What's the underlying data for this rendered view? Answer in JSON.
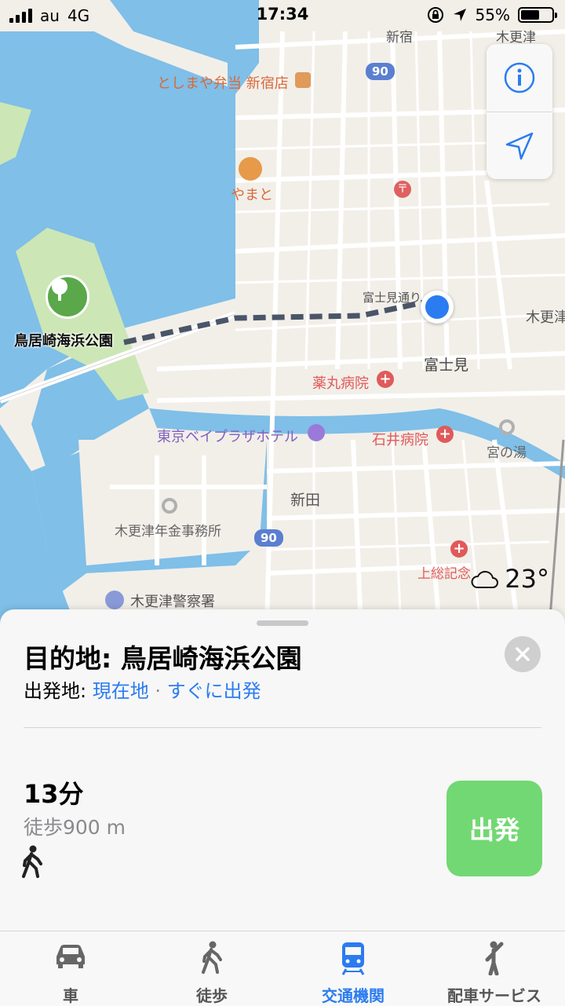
{
  "status_bar": {
    "carrier": "au",
    "network": "4G",
    "time": "17:34",
    "battery": "55%",
    "battery_level": 0.55
  },
  "map": {
    "labels": {
      "shinshuku_top": "新宿",
      "kisarazu_top": "木更津",
      "route_90_top": "90",
      "toshimaya": "としまや弁当 新宿店",
      "yamato": "やまと",
      "fujimi_street": "富士見通り",
      "kisarazu_right": "木更津",
      "park": "鳥居崎海浜公園",
      "fujimi": "富士見",
      "yakumaru": "薬丸病院",
      "hotel": "東京ベイプラザホテル",
      "ishii": "石井病院",
      "miyanoyu": "宮の湯",
      "shinden": "新田",
      "pension": "木更津年金事務所",
      "route_90_bottom": "90",
      "kazusa": "上総記念",
      "police": "木更津警察署"
    },
    "colors": {
      "water": "#7fbfe8",
      "land": "#f2efe9",
      "park": "#cde6b6",
      "route": "#4a5568",
      "user_dot": "#2b7cf0"
    }
  },
  "map_controls": {
    "info_icon": "info-icon",
    "location_icon": "location-arrow-icon"
  },
  "weather": {
    "icon": "cloud-icon",
    "temperature": "23°"
  },
  "route_sheet": {
    "destination_title": "目的地: 鳥居崎海浜公園",
    "origin_label": "出発地: ",
    "origin_value": "現在地",
    "separator": " · ",
    "departure_value": "すぐに出発",
    "duration": "13分",
    "distance": "徒歩900 m",
    "mode_icon": "walking-icon",
    "go_button": "出発",
    "accent": "#2b7cf0",
    "go_color": "#72d873"
  },
  "tabs": [
    {
      "label": "車",
      "icon": "car-icon",
      "active": false
    },
    {
      "label": "徒歩",
      "icon": "walking-icon",
      "active": false
    },
    {
      "label": "交通機関",
      "icon": "train-icon",
      "active": true
    },
    {
      "label": "配車サービス",
      "icon": "rideshare-icon",
      "active": false
    }
  ]
}
